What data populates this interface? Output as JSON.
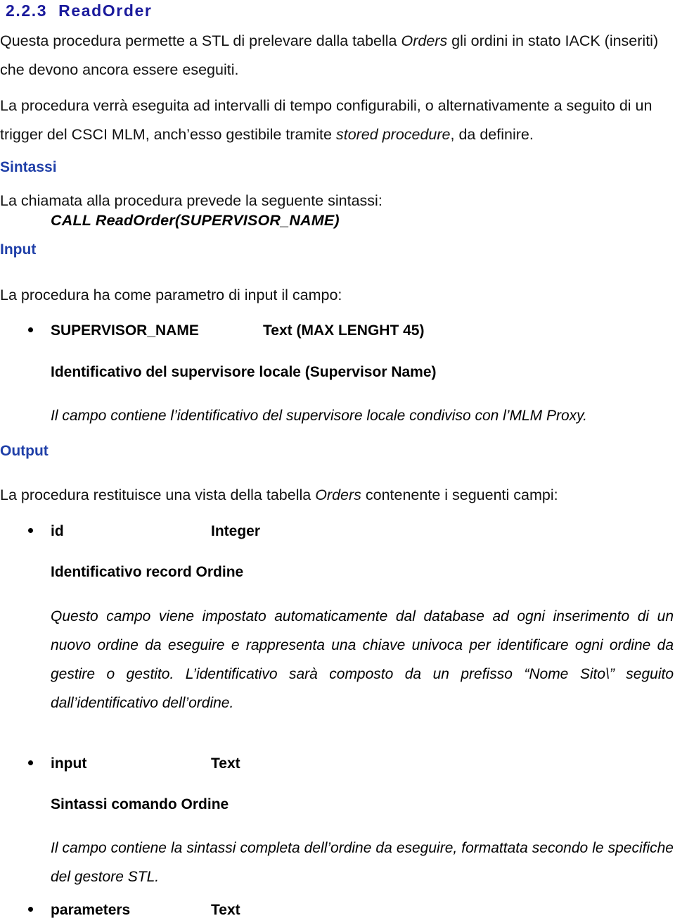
{
  "document": {
    "heading": {
      "number": "2.2.3",
      "title": "ReadOrder"
    },
    "intro_paragraph_1": "Questa procedura permette a STL di prelevare dalla tabella <i>Orders</i> gli ordini in stato IACK (inseriti) che devono ancora essere eseguiti.",
    "intro_paragraph_2": "La procedura verrà eseguita ad intervalli di tempo configurabili, o alternativamente a seguito di un trigger del CSCI MLM, anch’esso gestibile tramite <i>stored procedure</i>, da definire.",
    "sections": {
      "sintassi": {
        "label": "Sintassi",
        "lead": "La chiamata alla procedura prevede la seguente sintassi:",
        "call": "CALL ReadOrder(SUPERVISOR_NAME)"
      },
      "input": {
        "label": "Input",
        "lead": "La procedura ha come parametro di input il campo:",
        "fields": [
          {
            "name": "SUPERVISOR_NAME",
            "type": "Text (MAX LENGHT 45)",
            "description": "Identificativo del supervisore locale (Supervisor Name)",
            "note": "Il campo contiene l’identificativo del supervisore locale condiviso con l’MLM Proxy."
          }
        ]
      },
      "output": {
        "label": "Output",
        "lead": "La procedura restituisce una vista della tabella <i>Orders</i> contenente i seguenti campi:",
        "fields": [
          {
            "name": "id",
            "type": "Integer",
            "description": "Identificativo record Ordine",
            "note": "Questo campo viene impostato automaticamente dal database ad ogni inserimento di un nuovo ordine da eseguire e rappresenta una chiave univoca per identificare ogni ordine da gestire o gestito. L’identificativo sarà composto da un prefisso “Nome Sito\\” seguito dall’identificativo dell’ordine."
          },
          {
            "name": "input",
            "type": "Text",
            "description": "Sintassi comando Ordine",
            "note": "Il campo contiene la sintassi completa dell’ordine da eseguire, formattata secondo le specifiche del gestore STL."
          },
          {
            "name": "parameters",
            "type": "Text",
            "description": "",
            "note": ""
          }
        ]
      }
    }
  },
  "colors": {
    "heading": "#1a1a9c",
    "section_label": "#1f3fa8",
    "body_text": "#111111",
    "background": "#ffffff"
  }
}
